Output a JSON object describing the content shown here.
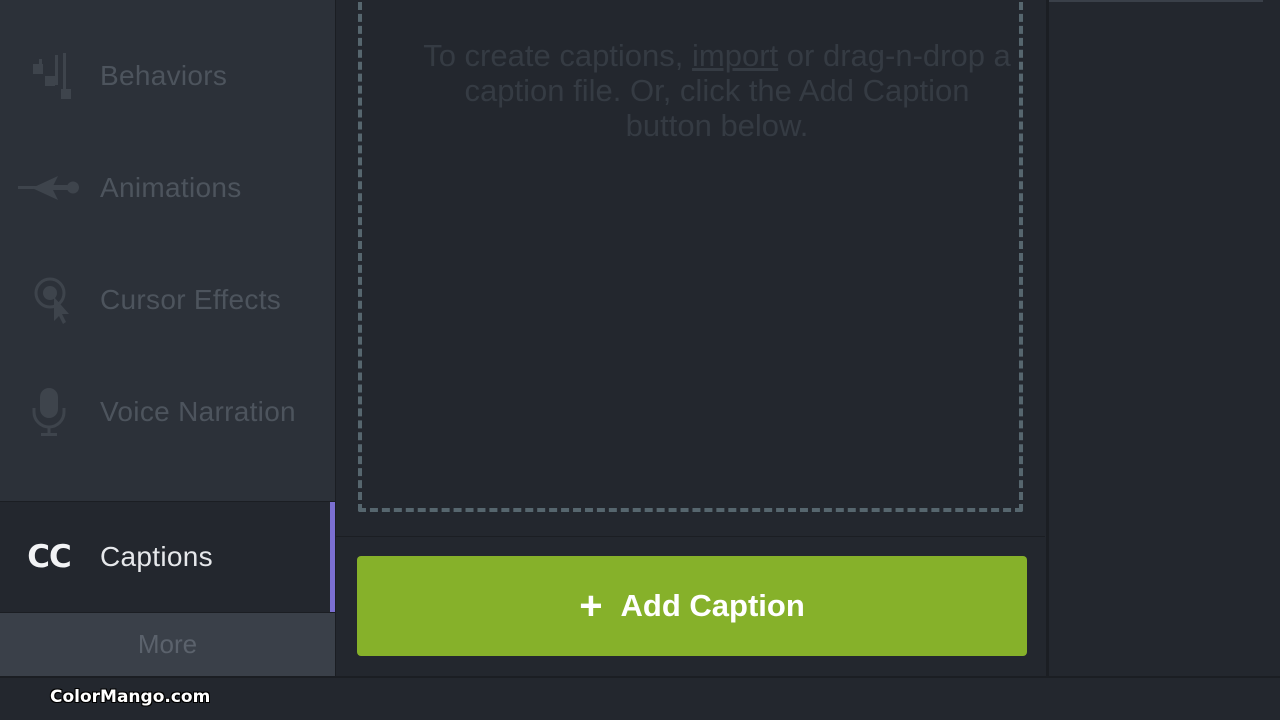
{
  "sidebar": {
    "items": [
      {
        "label": "Behaviors",
        "icon": "behaviors-icon"
      },
      {
        "label": "Animations",
        "icon": "animations-icon"
      },
      {
        "label": "Cursor Effects",
        "icon": "cursor-effects-icon"
      },
      {
        "label": "Voice Narration",
        "icon": "microphone-icon"
      },
      {
        "label": "Captions",
        "icon": "cc-icon",
        "icon_text": "CC",
        "active": true
      }
    ],
    "more_label": "More"
  },
  "captions_panel": {
    "empty_text_before": "To create captions, ",
    "empty_text_link": "import",
    "empty_text_after": " or drag-n-drop a caption file. Or, click the Add Caption button below.",
    "add_button": {
      "plus": "+",
      "label": "Add Caption"
    }
  },
  "watermark": "ColorMango.com",
  "colors": {
    "accent_green": "#86b12a",
    "active_indicator": "#7b6fd1",
    "background": "#23272e",
    "sidebar": "#2c3139"
  }
}
